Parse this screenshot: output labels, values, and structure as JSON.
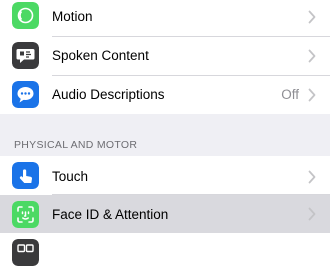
{
  "groups": [
    {
      "items": [
        {
          "label": "Motion",
          "value": "",
          "icon": "motion-icon",
          "icon_color": "#4cd964"
        },
        {
          "label": "Spoken Content",
          "value": "",
          "icon": "spoken-content-icon",
          "icon_color": "#3a3a3c"
        },
        {
          "label": "Audio Descriptions",
          "value": "Off",
          "icon": "audio-descriptions-icon",
          "icon_color": "#1a73e8"
        }
      ]
    },
    {
      "header": "PHYSICAL AND MOTOR",
      "items": [
        {
          "label": "Touch",
          "value": "",
          "icon": "touch-icon",
          "icon_color": "#1a73e8"
        },
        {
          "label": "Face ID & Attention",
          "value": "",
          "icon": "face-id-icon",
          "icon_color": "#4cd964",
          "highlighted": true
        },
        {
          "label": "",
          "value": "",
          "icon": "switch-control-icon",
          "icon_color": "#3a3a3c"
        }
      ]
    }
  ],
  "colors": {
    "background": "#efeff4",
    "separator": "#d7d7dc",
    "secondary_text": "#8e8e93",
    "chevron": "#c4c4c7"
  }
}
